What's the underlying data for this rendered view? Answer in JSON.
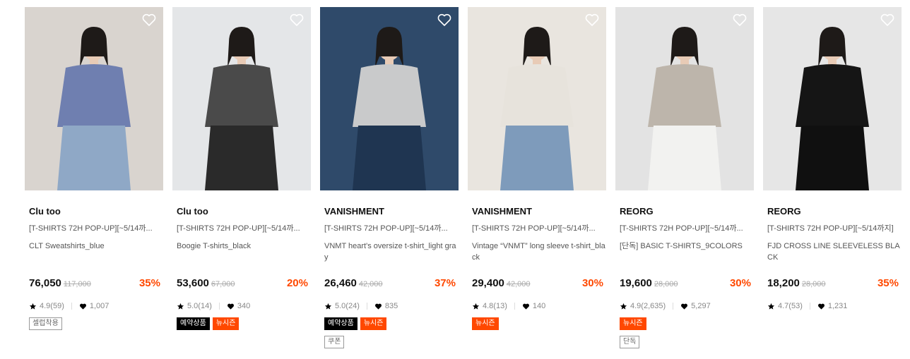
{
  "products": [
    {
      "brand": "Clu too",
      "title": "[T-SHIRTS 72H POP-UP][~5/14까...",
      "name": "CLT Sweatshirts_blue",
      "price": "76,050",
      "original_price": "117,000",
      "discount": "35%",
      "rating": "4.9(59)",
      "likes": "1,007",
      "tags": [
        {
          "label": "셀럽착용",
          "style": "outline"
        }
      ],
      "photo_bg": "#d9d4cf",
      "photo_top": "#6f7fb0",
      "photo_bottom": "#8fa8c6"
    },
    {
      "brand": "Clu too",
      "title": "[T-SHIRTS 72H POP-UP][~5/14까...",
      "name": "Boogie T-shirts_black",
      "price": "53,600",
      "original_price": "67,000",
      "discount": "20%",
      "rating": "5.0(14)",
      "likes": "340",
      "tags": [
        {
          "label": "예약상품",
          "style": "black"
        },
        {
          "label": "뉴시즌",
          "style": "orange"
        }
      ],
      "photo_bg": "#e4e6e8",
      "photo_top": "#4a4a4a",
      "photo_bottom": "#2a2a2a"
    },
    {
      "brand": "VANISHMENT",
      "title": "[T-SHIRTS 72H POP-UP][~5/14까...",
      "name": "VNMT heart's oversize t-shirt_light gray",
      "price": "26,460",
      "original_price": "42,000",
      "discount": "37%",
      "rating": "5.0(24)",
      "likes": "835",
      "tags": [
        {
          "label": "예약상품",
          "style": "black"
        },
        {
          "label": "뉴시즌",
          "style": "orange"
        },
        {
          "label": "쿠폰",
          "style": "outline"
        }
      ],
      "photo_bg": "#2f4a6a",
      "photo_top": "#c9cacb",
      "photo_bottom": "#1f3551"
    },
    {
      "brand": "VANISHMENT",
      "title": "[T-SHIRTS 72H POP-UP][~5/14까...",
      "name": "Vintage “VNMT” long sleeve t-shirt_black",
      "price": "29,400",
      "original_price": "42,000",
      "discount": "30%",
      "rating": "4.8(13)",
      "likes": "140",
      "tags": [
        {
          "label": "뉴시즌",
          "style": "orange"
        }
      ],
      "photo_bg": "#e9e5df",
      "photo_top": "#e7e3dc",
      "photo_bottom": "#7e9bbb"
    },
    {
      "brand": "REORG",
      "title": "[T-SHIRTS 72H POP-UP][~5/14까...",
      "name": "[단독] BASIC T-SHIRTS_9COLORS",
      "price": "19,600",
      "original_price": "28,000",
      "discount": "30%",
      "rating": "4.9(2,635)",
      "likes": "5,297",
      "tags": [
        {
          "label": "뉴시즌",
          "style": "orange"
        },
        {
          "label": "단독",
          "style": "outline"
        }
      ],
      "photo_bg": "#e3e3e3",
      "photo_top": "#bdb5ab",
      "photo_bottom": "#f2f2f0"
    },
    {
      "brand": "REORG",
      "title": "[T-SHIRTS 72H POP-UP][~5/14까지]",
      "name": "FJD CROSS LINE SLEEVELESS BLACK",
      "price": "18,200",
      "original_price": "28,000",
      "discount": "35%",
      "rating": "4.7(53)",
      "likes": "1,231",
      "tags": [],
      "photo_bg": "#e6e6e6",
      "photo_top": "#151515",
      "photo_bottom": "#101010"
    }
  ],
  "colors": {
    "discount": "#ff4800",
    "tag_black": "#000000",
    "tag_orange": "#ff4800"
  },
  "icons": {
    "wishlist": "heart-outline-icon",
    "rating": "star-icon",
    "likes": "heart-icon"
  }
}
